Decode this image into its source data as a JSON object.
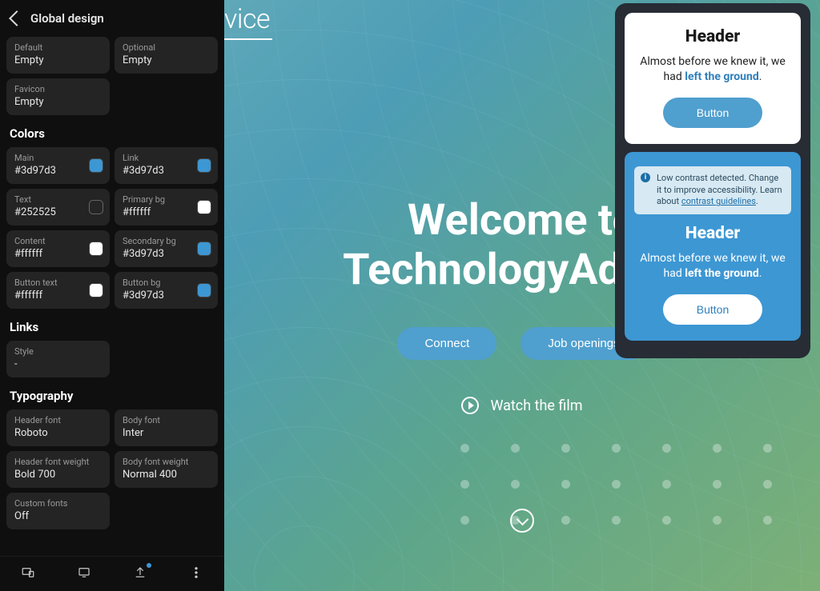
{
  "panel": {
    "title": "Global design",
    "imageFields": [
      {
        "label": "Default",
        "value": "Empty"
      },
      {
        "label": "Optional",
        "value": "Empty"
      },
      {
        "label": "Favicon",
        "value": "Empty"
      }
    ],
    "colorsTitle": "Colors",
    "colors": [
      {
        "label": "Main",
        "value": "#3d97d3",
        "swatch": "#3d97d3"
      },
      {
        "label": "Link",
        "value": "#3d97d3",
        "swatch": "#3d97d3"
      },
      {
        "label": "Text",
        "value": "#252525",
        "swatch": "#252525"
      },
      {
        "label": "Primary bg",
        "value": "#ffffff",
        "swatch": "#ffffff"
      },
      {
        "label": "Content",
        "value": "#ffffff",
        "swatch": "#ffffff"
      },
      {
        "label": "Secondary bg",
        "value": "#3d97d3",
        "swatch": "#3d97d3"
      },
      {
        "label": "Button text",
        "value": "#ffffff",
        "swatch": "#ffffff"
      },
      {
        "label": "Button bg",
        "value": "#3d97d3",
        "swatch": "#3d97d3"
      }
    ],
    "linksTitle": "Links",
    "linksStyle": {
      "label": "Style",
      "value": "-"
    },
    "typographyTitle": "Typography",
    "typography": [
      {
        "label": "Header font",
        "value": "Roboto"
      },
      {
        "label": "Body font",
        "value": "Inter"
      },
      {
        "label": "Header font weight",
        "value": "Bold 700"
      },
      {
        "label": "Body font weight",
        "value": "Normal 400"
      },
      {
        "label": "Custom fonts",
        "value": "Off"
      }
    ]
  },
  "canvas": {
    "brandFragment": "vice",
    "heroLine1": "Welcome to",
    "heroLine2": "TechnologyAdvice",
    "btn1": "Connect",
    "btn2": "Job openings",
    "watch": "Watch the film"
  },
  "preview": {
    "light": {
      "header": "Header",
      "body_a": "Almost before we knew it, we had ",
      "body_b": "left the ground",
      "body_c": ".",
      "button": "Button"
    },
    "alert": {
      "text": "Low contrast detected. Change it to improve accessibility. Learn about ",
      "linkText": "contrast guidelines",
      "after": "."
    },
    "dark": {
      "header": "Header",
      "body_a": "Almost before we knew it, we had ",
      "body_b": "left the ground",
      "body_c": ".",
      "button": "Button"
    }
  }
}
